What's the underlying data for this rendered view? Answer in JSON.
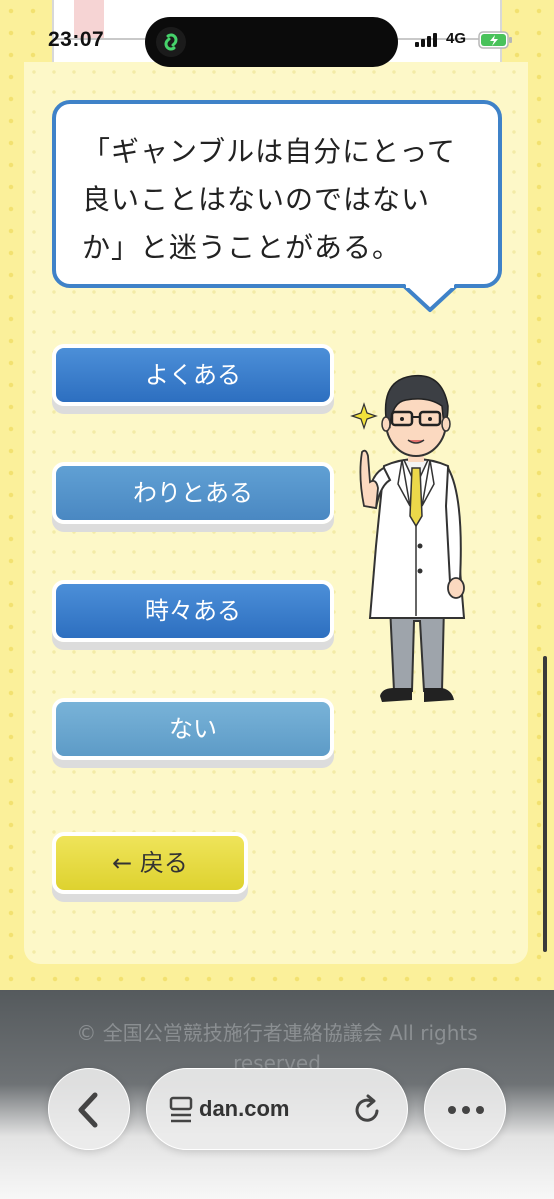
{
  "status_bar": {
    "time": "23:07",
    "network": "4G"
  },
  "question": {
    "text": "「ギャンブルは自分にとって良いことはないのではないか」と迷うことがある。"
  },
  "choices": [
    {
      "label": "よくある"
    },
    {
      "label": "わりとある"
    },
    {
      "label": "時々ある"
    },
    {
      "label": "ない"
    }
  ],
  "back_button": {
    "label": "← 戻る"
  },
  "footer": {
    "copyright": "© 全国公営競技施行者連絡協議会 All rights reserved"
  },
  "browser": {
    "url": "dan.com"
  },
  "colors": {
    "page_background": "#fbf09a",
    "bubble_border": "#3f82c8",
    "choice_dark": "#2d6fc0",
    "choice_light": "#5d9bc7",
    "back_button": "#e6dc45"
  }
}
